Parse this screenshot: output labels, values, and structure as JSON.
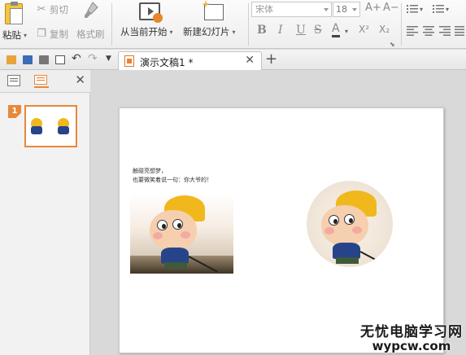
{
  "ribbon": {
    "paste_label": "粘贴",
    "cut_label": "剪切",
    "copy_label": "复制",
    "format_painter_label": "格式刷",
    "from_current_label": "从当前开始",
    "new_slide_label": "新建幻灯片",
    "font_name": "宋体",
    "font_size": "18",
    "grow_font_glyph": "A+",
    "shrink_font_glyph": "A−",
    "bold_glyph": "B",
    "italic_glyph": "I",
    "underline_glyph": "U",
    "strike_glyph": "S",
    "font_color_glyph": "A",
    "superscript_glyph": "X²",
    "subscript_glyph": "X₂"
  },
  "tabbar": {
    "doc_title": "演示文稿1 *",
    "close_glyph": "✕",
    "add_glyph": "+"
  },
  "left_pane": {
    "close_glyph": "✕",
    "slide_number": "1"
  },
  "slide": {
    "photo_caption_line1": "触碰亮想梦，",
    "photo_caption_line2": "也要微笑着说一句：你大爷的！"
  },
  "watermark": {
    "line1": "无忧电脑学习网",
    "line2": "wypcw.com"
  },
  "colors": {
    "accent_orange": "#e8883a",
    "cap_yellow": "#f0b81d",
    "shirt_blue": "#27448a"
  }
}
